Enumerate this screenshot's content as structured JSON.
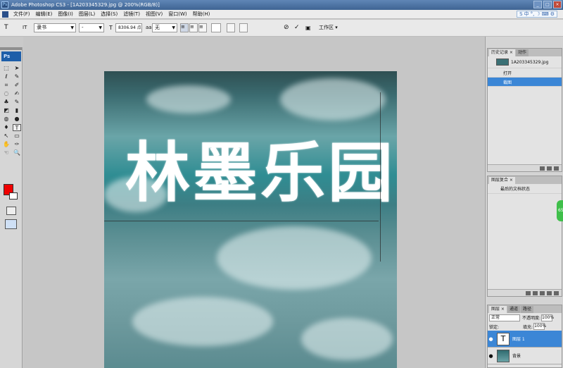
{
  "window": {
    "title": "Adobe Photoshop CS3 - [1A203345329.jpg @ 200%(RGB/8)]",
    "app_icon": "Ps",
    "buttons": [
      "_",
      "□",
      "×"
    ]
  },
  "menu": {
    "items": [
      "文件(F)",
      "编辑(E)",
      "图像(I)",
      "图层(L)",
      "选择(S)",
      "滤镜(T)",
      "视图(V)",
      "窗口(W)",
      "帮助(H)"
    ],
    "ime": [
      "S",
      "中",
      "°,",
      "☽",
      "⌨",
      "⚙"
    ]
  },
  "options": {
    "tool_glyph": "T",
    "orient_glyph": "IT",
    "font_family": "隶书",
    "font_style": "-",
    "size_icon": "T",
    "font_size": "8306.94 点",
    "aa_icon": "aa",
    "anti_alias": "无",
    "align": [
      "≡",
      "≡",
      "≡"
    ],
    "workspace_label": "工作区 ▾",
    "cancel_glyph": "⊘",
    "commit_glyph": "✓"
  },
  "tools": {
    "badge": "Ps",
    "glyphs": [
      "⬚",
      "➤",
      "ℓ",
      "✎",
      "⌗",
      "✐",
      "◌",
      "✍",
      "♣",
      "✎",
      "◩",
      "▮",
      "◍",
      "●",
      "♦",
      "T",
      "↖",
      "▭",
      "✋",
      "✑",
      "☜",
      "🔍"
    ],
    "selected_index": 15,
    "fg_color": "#f00000",
    "bg_color": "#ffffff"
  },
  "document": {
    "text": "林墨乐园"
  },
  "history": {
    "tabs": [
      "历史记录 ×",
      "动作"
    ],
    "snapshot": "1A203345329.jpg",
    "items": [
      "打开",
      "裁图"
    ],
    "selected": 1
  },
  "layercomps": {
    "tabs": [
      "图层复合 ×"
    ],
    "item": "最后的文档状态"
  },
  "layers": {
    "tabs": [
      "图层 ×",
      "通道",
      "路径"
    ],
    "blend_mode": "正常",
    "opacity_label": "不透明度:",
    "opacity_value": "100%",
    "lock_label": "锁定:",
    "fill_label": "填充:",
    "fill_value": "100%",
    "rows": [
      {
        "name": "图层 1",
        "thumb": "T",
        "selected": true
      },
      {
        "name": "背景",
        "thumb": "",
        "selected": false
      }
    ]
  },
  "side_badge": "65"
}
